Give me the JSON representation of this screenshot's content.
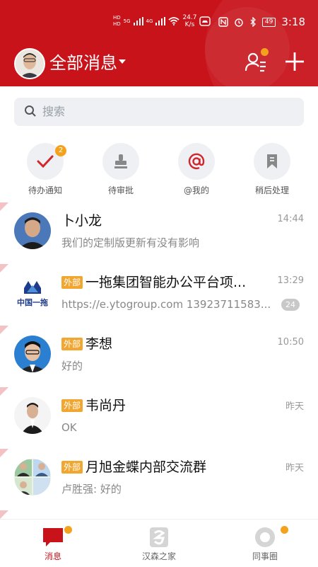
{
  "status_bar": {
    "hd1": "HD",
    "hd2": "HD",
    "net1": "5G",
    "net2": "4G",
    "speed_value": "24.7",
    "speed_unit": "K/s",
    "battery": "49",
    "time": "3:18"
  },
  "header": {
    "title": "全部消息",
    "icons": {
      "contacts": "contacts-icon",
      "add": "plus-icon"
    },
    "accent": "#c8131b"
  },
  "search": {
    "placeholder": "搜索"
  },
  "quick_actions": [
    {
      "label": "待办通知",
      "icon": "check-icon",
      "badge": "2"
    },
    {
      "label": "待审批",
      "icon": "stamp-icon"
    },
    {
      "label": "@我的",
      "icon": "at-icon"
    },
    {
      "label": "稍后处理",
      "icon": "bookmark-icon"
    }
  ],
  "messages": [
    {
      "title": "卜小龙",
      "preview": "我们的定制版更新有没有影响",
      "time": "14:44"
    },
    {
      "tag": "外部",
      "title": "一拖集团智能办公平台项...",
      "preview": "https://e.ytogroup.com 13923711583...",
      "time": "13:29",
      "count": "24",
      "logo_text": "中国一拖"
    },
    {
      "tag": "外部",
      "title": "李想",
      "preview": "好的",
      "time": "10:50"
    },
    {
      "tag": "外部",
      "title": "韦尚丹",
      "preview": "OK",
      "time": "昨天"
    },
    {
      "tag": "外部",
      "title": "月旭金蝶内部交流群",
      "preview": "卢胜强: 好的",
      "time": "昨天"
    }
  ],
  "bottom_nav": [
    {
      "label": "消息",
      "active": true
    },
    {
      "label": "汉森之家",
      "active": false
    },
    {
      "label": "同事圈",
      "active": false
    }
  ],
  "colors": {
    "tag": "#f1a630",
    "badge": "#f4a21d"
  }
}
